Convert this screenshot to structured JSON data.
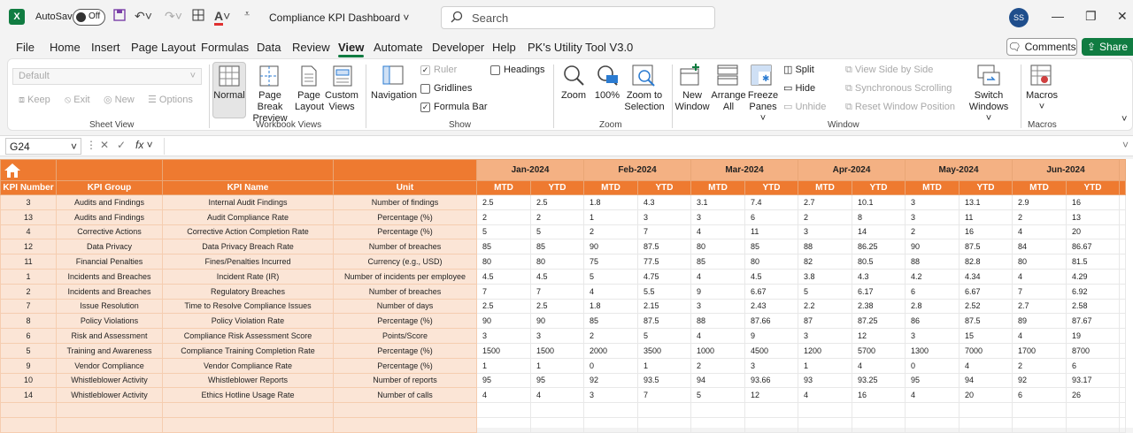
{
  "titlebar": {
    "autosave_label": "AutoSave",
    "autosave_state": "Off",
    "document_title": "Compliance KPI Dashboard",
    "search_placeholder": "Search",
    "avatar_initials": "SS"
  },
  "menu": [
    "File",
    "Home",
    "Insert",
    "Page Layout",
    "Formulas",
    "Data",
    "Review",
    "View",
    "Automate",
    "Developer",
    "Help",
    "PK's Utility Tool V3.0"
  ],
  "menu_active": "View",
  "actions": {
    "comments": "Comments",
    "share": "Share"
  },
  "ribbon": {
    "sheet_view": {
      "dropdown": "Default",
      "keep": "Keep",
      "exit": "Exit",
      "new": "New",
      "options": "Options",
      "label": "Sheet View"
    },
    "workbook_views": {
      "normal": "Normal",
      "page_break_1": "Page Break",
      "page_break_2": "Preview",
      "page_layout_1": "Page",
      "page_layout_2": "Layout",
      "custom_1": "Custom",
      "custom_2": "Views",
      "label": "Workbook Views"
    },
    "show": {
      "navigation": "Navigation",
      "ruler": "Ruler",
      "gridlines": "Gridlines",
      "formula_bar": "Formula Bar",
      "headings": "Headings",
      "label": "Show"
    },
    "zoom": {
      "zoom": "Zoom",
      "hundred": "100%",
      "zoom_sel_1": "Zoom to",
      "zoom_sel_2": "Selection",
      "label": "Zoom"
    },
    "window": {
      "new_1": "New",
      "new_2": "Window",
      "arrange_1": "Arrange",
      "arrange_2": "All",
      "freeze_1": "Freeze",
      "freeze_2": "Panes",
      "split": "Split",
      "hide": "Hide",
      "unhide": "Unhide",
      "side_by_side": "View Side by Side",
      "sync_scroll": "Synchronous Scrolling",
      "reset_pos": "Reset Window Position",
      "switch_1": "Switch",
      "switch_2": "Windows",
      "label": "Window"
    },
    "macros": {
      "macros": "Macros",
      "label": "Macros"
    }
  },
  "formula_bar": {
    "name_box": "G24",
    "fx": "fx",
    "value": ""
  },
  "table": {
    "headers": [
      "KPI Number",
      "KPI Group",
      "KPI Name",
      "Unit"
    ],
    "months": [
      "Jan-2024",
      "Feb-2024",
      "Mar-2024",
      "Apr-2024",
      "May-2024",
      "Jun-2024"
    ],
    "sub": [
      "MTD",
      "YTD"
    ],
    "rows": [
      {
        "num": "3",
        "group": "Audits and Findings",
        "name": "Internal Audit Findings",
        "unit": "Number of findings",
        "vals": [
          "2.5",
          "2.5",
          "1.8",
          "4.3",
          "3.1",
          "7.4",
          "2.7",
          "10.1",
          "3",
          "13.1",
          "2.9",
          "16"
        ]
      },
      {
        "num": "13",
        "group": "Audits and Findings",
        "name": "Audit Compliance Rate",
        "unit": "Percentage (%)",
        "vals": [
          "2",
          "2",
          "1",
          "3",
          "3",
          "6",
          "2",
          "8",
          "3",
          "11",
          "2",
          "13"
        ]
      },
      {
        "num": "4",
        "group": "Corrective Actions",
        "name": "Corrective Action Completion Rate",
        "unit": "Percentage (%)",
        "vals": [
          "5",
          "5",
          "2",
          "7",
          "4",
          "11",
          "3",
          "14",
          "2",
          "16",
          "4",
          "20"
        ]
      },
      {
        "num": "12",
        "group": "Data Privacy",
        "name": "Data Privacy Breach Rate",
        "unit": "Number of breaches",
        "vals": [
          "85",
          "85",
          "90",
          "87.5",
          "80",
          "85",
          "88",
          "86.25",
          "90",
          "87.5",
          "84",
          "86.67"
        ]
      },
      {
        "num": "11",
        "group": "Financial Penalties",
        "name": "Fines/Penalties Incurred",
        "unit": "Currency (e.g., USD)",
        "vals": [
          "80",
          "80",
          "75",
          "77.5",
          "85",
          "80",
          "82",
          "80.5",
          "88",
          "82.8",
          "80",
          "81.5"
        ]
      },
      {
        "num": "1",
        "group": "Incidents and Breaches",
        "name": "Incident Rate (IR)",
        "unit": "Number of incidents per employee",
        "vals": [
          "4.5",
          "4.5",
          "5",
          "4.75",
          "4",
          "4.5",
          "3.8",
          "4.3",
          "4.2",
          "4.34",
          "4",
          "4.29"
        ]
      },
      {
        "num": "2",
        "group": "Incidents and Breaches",
        "name": "Regulatory Breaches",
        "unit": "Number of breaches",
        "vals": [
          "7",
          "7",
          "4",
          "5.5",
          "9",
          "6.67",
          "5",
          "6.17",
          "6",
          "6.67",
          "7",
          "6.92"
        ]
      },
      {
        "num": "7",
        "group": "Issue Resolution",
        "name": "Time to Resolve Compliance Issues",
        "unit": "Number of days",
        "vals": [
          "2.5",
          "2.5",
          "1.8",
          "2.15",
          "3",
          "2.43",
          "2.2",
          "2.38",
          "2.8",
          "2.52",
          "2.7",
          "2.58"
        ]
      },
      {
        "num": "8",
        "group": "Policy Violations",
        "name": "Policy Violation Rate",
        "unit": "Percentage (%)",
        "vals": [
          "90",
          "90",
          "85",
          "87.5",
          "88",
          "87.66",
          "87",
          "87.25",
          "86",
          "87.5",
          "89",
          "87.67"
        ]
      },
      {
        "num": "6",
        "group": "Risk and Assessment",
        "name": "Compliance Risk Assessment Score",
        "unit": "Points/Score",
        "vals": [
          "3",
          "3",
          "2",
          "5",
          "4",
          "9",
          "3",
          "12",
          "3",
          "15",
          "4",
          "19"
        ]
      },
      {
        "num": "5",
        "group": "Training and Awareness",
        "name": "Compliance Training Completion Rate",
        "unit": "Percentage (%)",
        "vals": [
          "1500",
          "1500",
          "2000",
          "3500",
          "1000",
          "4500",
          "1200",
          "5700",
          "1300",
          "7000",
          "1700",
          "8700"
        ]
      },
      {
        "num": "9",
        "group": "Vendor Compliance",
        "name": "Vendor Compliance Rate",
        "unit": "Percentage (%)",
        "vals": [
          "1",
          "1",
          "0",
          "1",
          "2",
          "3",
          "1",
          "4",
          "0",
          "4",
          "2",
          "6"
        ]
      },
      {
        "num": "10",
        "group": "Whistleblower Activity",
        "name": "Whistleblower Reports",
        "unit": "Number of reports",
        "vals": [
          "95",
          "95",
          "92",
          "93.5",
          "94",
          "93.66",
          "93",
          "93.25",
          "95",
          "94",
          "92",
          "93.17"
        ]
      },
      {
        "num": "14",
        "group": "Whistleblower Activity",
        "name": "Ethics Hotline Usage Rate",
        "unit": "Number of calls",
        "vals": [
          "4",
          "4",
          "3",
          "7",
          "5",
          "12",
          "4",
          "16",
          "4",
          "20",
          "6",
          "26"
        ]
      }
    ]
  },
  "colors": {
    "excel_green": "#107c41",
    "header_orange": "#ee7a30",
    "month_peach": "#f4b183",
    "cell_peach": "#fbe5d6"
  }
}
